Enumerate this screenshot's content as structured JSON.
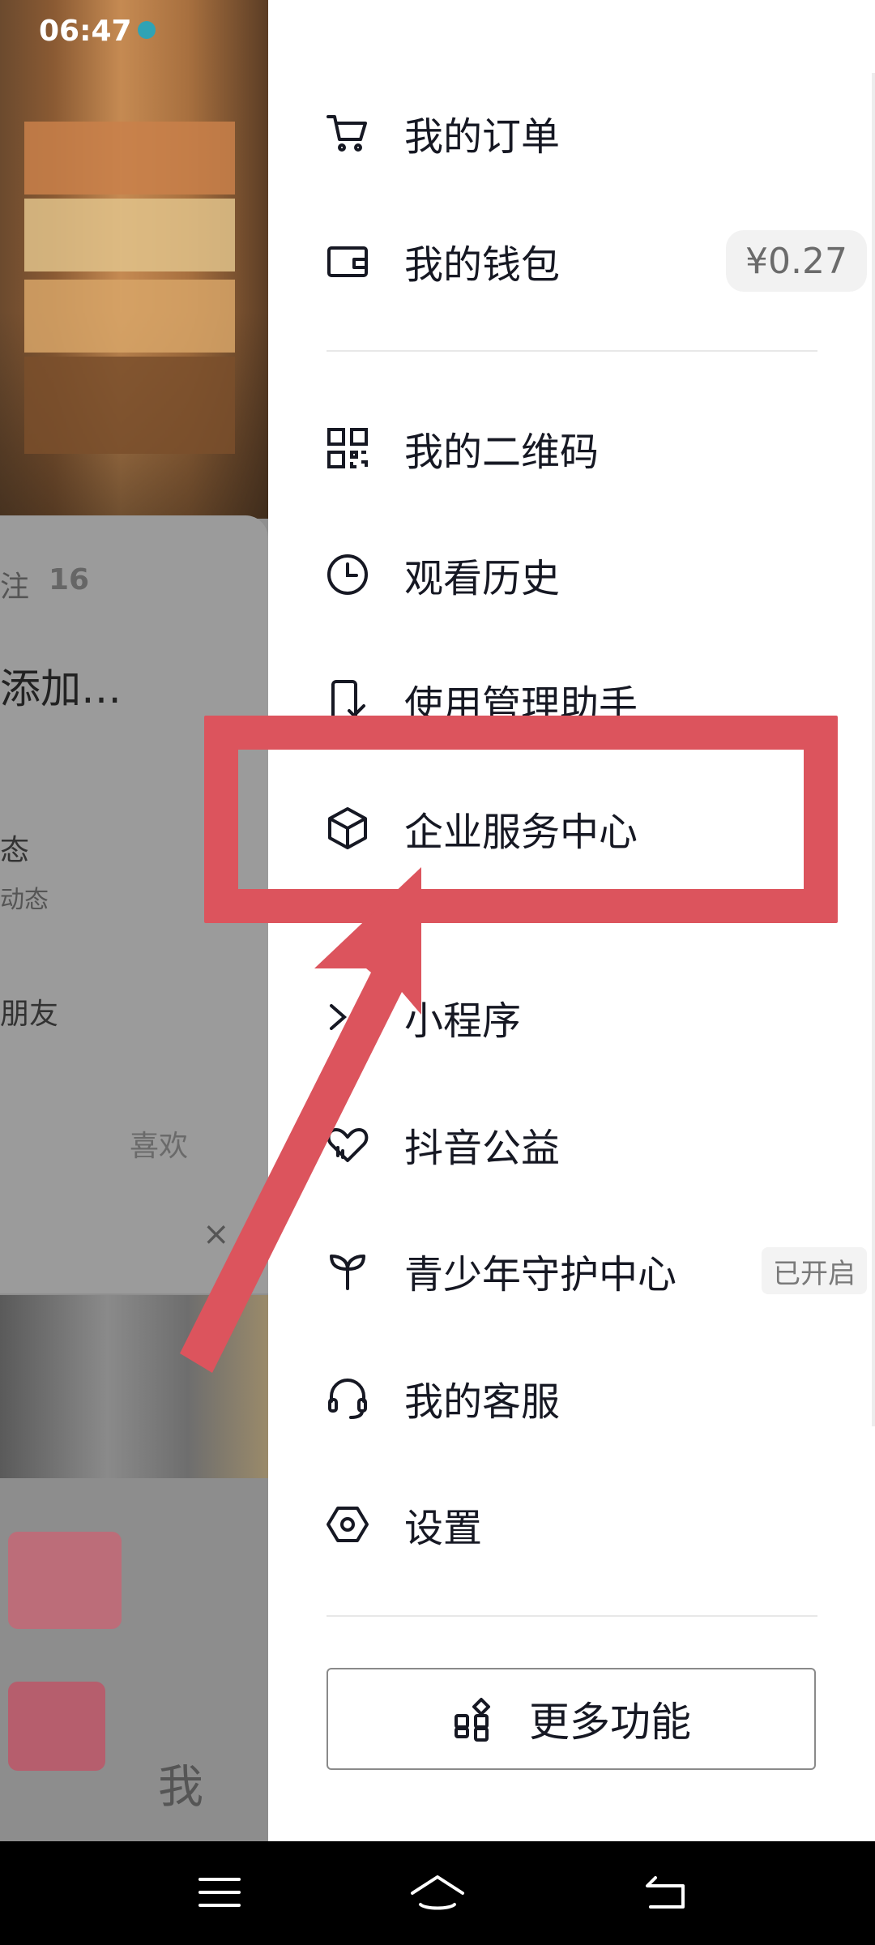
{
  "status_bar": {
    "time": "06:47"
  },
  "background_profile": {
    "following_label": "注",
    "stats_text": "16",
    "name_text": "添加…",
    "moments_title": "态",
    "moments_sub": "动态",
    "friends_label": "朋友",
    "likes_label": "喜欢",
    "me_label": "我"
  },
  "drawer": {
    "items": [
      {
        "key": "orders",
        "label": "我的订单",
        "icon": "cart-icon"
      },
      {
        "key": "wallet",
        "label": "我的钱包",
        "icon": "wallet-icon",
        "badge": "¥0.27"
      },
      {
        "key": "qrcode",
        "label": "我的二维码",
        "icon": "qrcode-icon"
      },
      {
        "key": "history",
        "label": "观看历史",
        "icon": "clock-icon"
      },
      {
        "key": "manager",
        "label": "使用管理助手",
        "icon": "phone-check-icon"
      },
      {
        "key": "enterprise",
        "label": "企业服务中心",
        "icon": "cube-icon"
      },
      {
        "key": "miniprogram",
        "label": "小程序",
        "icon": "miniprogram-icon"
      },
      {
        "key": "charity",
        "label": "抖音公益",
        "icon": "heart-icon"
      },
      {
        "key": "teen",
        "label": "青少年守护中心",
        "icon": "sprout-icon",
        "badge": "已开启"
      },
      {
        "key": "service",
        "label": "我的客服",
        "icon": "headset-icon"
      },
      {
        "key": "settings",
        "label": "设置",
        "icon": "hexagon-settings-icon"
      }
    ],
    "more_button": {
      "label": "更多功能",
      "icon": "grid-icon"
    }
  },
  "annotation": {
    "highlight_color": "#dc545d",
    "target": "企业服务中心"
  },
  "navbar": {
    "icons": [
      "menu-icon",
      "home-icon",
      "back-icon"
    ]
  }
}
